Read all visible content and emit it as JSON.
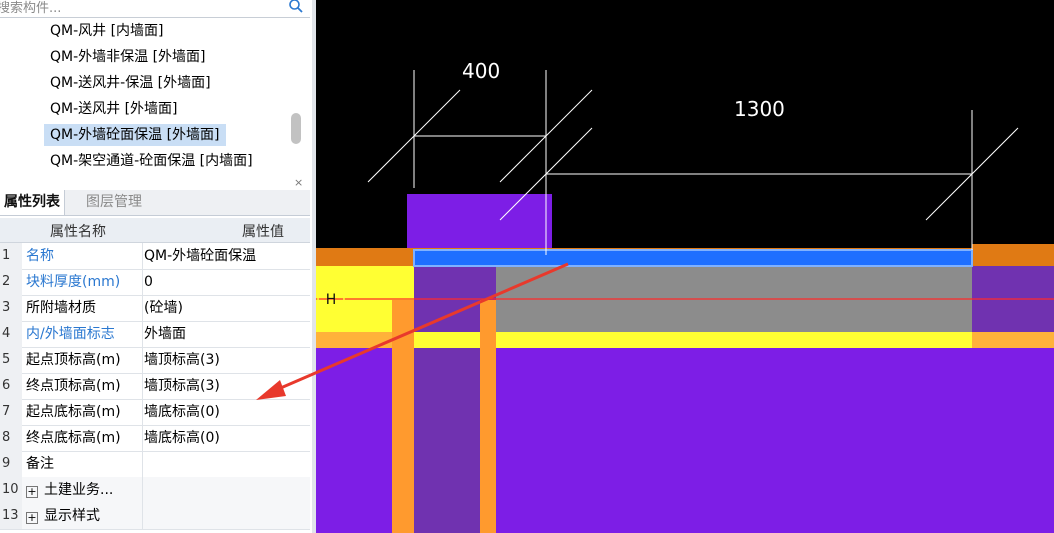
{
  "search": {
    "placeholder": "搜索构件..."
  },
  "components": [
    {
      "label": "QM-风井 [内墙面]"
    },
    {
      "label": "QM-外墙非保温 [外墙面]"
    },
    {
      "label": "QM-送风井-保温 [外墙面]"
    },
    {
      "label": "QM-送风井 [外墙面]"
    },
    {
      "label": "QM-外墙砼面保温 [外墙面]",
      "selected": true
    },
    {
      "label": "QM-架空通道-砼面保温 [内墙面]"
    }
  ],
  "panel": {
    "close": "×"
  },
  "tabs": {
    "properties": "属性列表",
    "layers": "图层管理"
  },
  "grid": {
    "header_name": "属性名称",
    "header_value": "属性值",
    "rows": [
      {
        "num": "1",
        "name": "名称",
        "value": "QM-外墙砼面保温",
        "blue": true
      },
      {
        "num": "2",
        "name": "块料厚度(mm)",
        "value": "0",
        "blue": true
      },
      {
        "num": "3",
        "name": "所附墙材质",
        "value": "(砼墙)"
      },
      {
        "num": "4",
        "name": "内/外墙面标志",
        "value": "外墙面",
        "blue": true
      },
      {
        "num": "5",
        "name": "起点顶标高(m)",
        "value": "墙顶标高(3)"
      },
      {
        "num": "6",
        "name": "终点顶标高(m)",
        "value": "墙顶标高(3)"
      },
      {
        "num": "7",
        "name": "起点底标高(m)",
        "value": "墙底标高(0)"
      },
      {
        "num": "8",
        "name": "终点底标高(m)",
        "value": "墙底标高(0)"
      },
      {
        "num": "9",
        "name": "备注",
        "value": ""
      },
      {
        "num": "10",
        "name": "土建业务...",
        "value": "",
        "expandable": true
      },
      {
        "num": "13",
        "name": "显示样式",
        "value": "",
        "expandable": true
      }
    ]
  },
  "drawing": {
    "dim_left": "400",
    "dim_right": "1300",
    "axis_label": "H",
    "colors": {
      "background": "#000000",
      "wall": "#7d1ee6",
      "orange": "#ff9a2e",
      "yellow": "#ffff33",
      "gray": "#8c8c8c",
      "blue_face": "#1e6fff",
      "axis_line": "#ff2a2a",
      "arrow": "#e8392c",
      "dim_lines": "#ffffff"
    }
  }
}
